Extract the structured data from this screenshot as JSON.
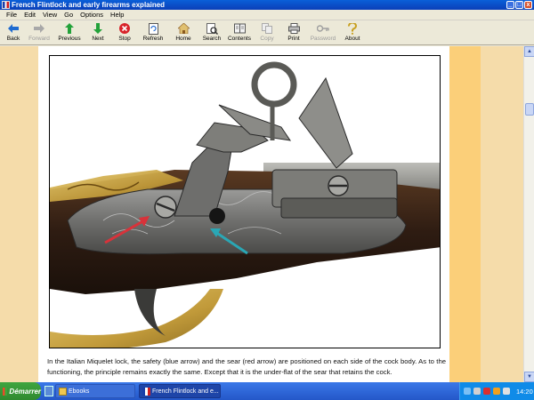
{
  "window": {
    "title": "French Flintlock and early firearms explained",
    "controls": {
      "minimize": "_",
      "maximize": "□",
      "close": "x"
    }
  },
  "menu": [
    "File",
    "Edit",
    "View",
    "Go",
    "Options",
    "Help"
  ],
  "toolbar": [
    {
      "label": "Back",
      "icon": "back-arrow-icon",
      "enabled": true
    },
    {
      "label": "Forward",
      "icon": "forward-arrow-icon",
      "enabled": false
    },
    {
      "label": "Previous",
      "icon": "up-arrow-icon",
      "enabled": true
    },
    {
      "label": "Next",
      "icon": "down-arrow-icon",
      "enabled": true
    },
    {
      "label": "Stop",
      "icon": "stop-icon",
      "enabled": true
    },
    {
      "label": "Refresh",
      "icon": "refresh-icon",
      "enabled": true
    },
    {
      "label": "Home",
      "icon": "home-icon",
      "enabled": true
    },
    {
      "label": "Search",
      "icon": "search-icon",
      "enabled": true
    },
    {
      "label": "Contents",
      "icon": "contents-icon",
      "enabled": true
    },
    {
      "label": "Copy",
      "icon": "copy-icon",
      "enabled": false
    },
    {
      "label": "Print",
      "icon": "print-icon",
      "enabled": true
    },
    {
      "label": "Password",
      "icon": "key-icon",
      "enabled": false
    },
    {
      "label": "About",
      "icon": "about-icon",
      "enabled": true
    }
  ],
  "page": {
    "caption": "In the Italian Miquelet lock, the safety (blue arrow) and the sear (red arrow) are positioned on each side of the cock body. As to the functioning, the principle remains exactly the same. Except that it is the under-flat of the sear that retains the cock."
  },
  "taskbar": {
    "start_label": "Démarrer",
    "tasks": [
      "Ebooks",
      "French Flintlock and e..."
    ],
    "clock": "14:20"
  },
  "colors": {
    "page_background": "#f5dcaa",
    "side_stripe": "#fbcf79",
    "safety_arrow": "#2aa7b5",
    "sear_arrow": "#d8323a"
  }
}
